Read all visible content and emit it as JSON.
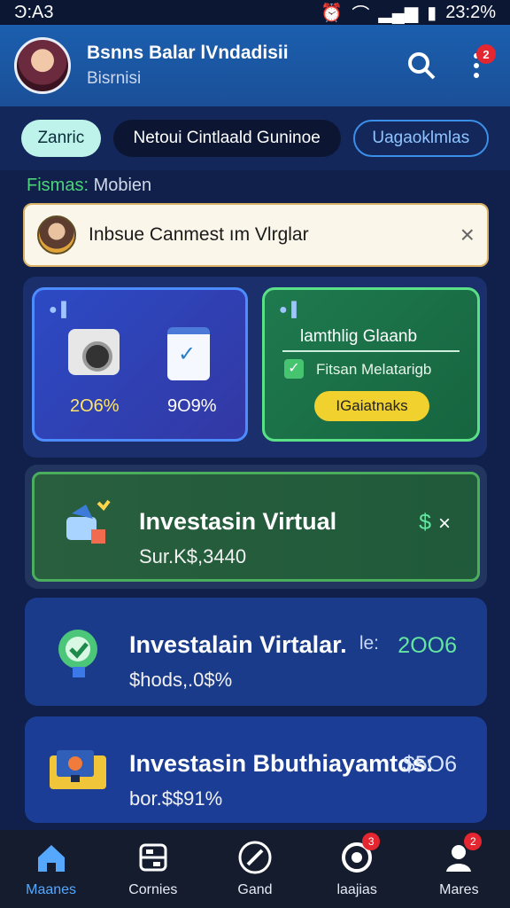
{
  "status_bar": {
    "time_left": "Ͽ:A3",
    "time_right": "23:2%"
  },
  "header": {
    "title": "Bsnns Balar lVndadisii",
    "subtitle": "Bisrnisi",
    "notification_count": "2",
    "icons": [
      "search-icon",
      "more-vertical-icon"
    ]
  },
  "chips": [
    "Zanric",
    "Netoui Cintlaald Guninoe",
    "Uagaoklmlas"
  ],
  "filter": {
    "label": "Fismas:",
    "value": "Mobien"
  },
  "search_card": {
    "text": "Inbsue Canmest ım Vlrglar"
  },
  "feature_tiles": {
    "blue": {
      "value_left": "2O6%",
      "value_right": "9O9%"
    },
    "green": {
      "title": "lamthlig Glaanb",
      "subtitle": "Fitsan Melatarigb",
      "button": "IGaiatnaks"
    }
  },
  "cards": [
    {
      "title": "Investasin Virtual",
      "subtitle": "Sur.K$,3440",
      "right": "$"
    },
    {
      "title": "Investalain Virtalar.",
      "subtitle": "$hods,.0$%",
      "right_prefix": "le:",
      "right": "2OO6"
    },
    {
      "title": "Investasin Bbuthiayamtos:",
      "subtitle": "bor.$$91%",
      "right": "$5O6"
    }
  ],
  "bottom_nav": [
    {
      "label": "Maanes",
      "icon": "home-icon"
    },
    {
      "label": "Cornies",
      "icon": "grid-icon"
    },
    {
      "label": "Gand",
      "icon": "compass-icon"
    },
    {
      "label": "laajias",
      "icon": "target-icon",
      "badge": "3"
    },
    {
      "label": "Mares",
      "icon": "user-icon",
      "badge": "2"
    }
  ],
  "colors": {
    "accent": "#56a8ff",
    "green": "#4aae5c",
    "badge": "#e3262f"
  }
}
